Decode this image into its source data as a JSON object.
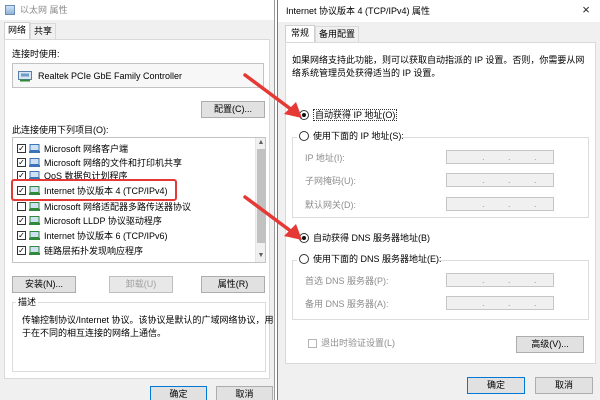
{
  "left_window": {
    "title": "以太网 属性",
    "tabs": [
      "网络",
      "共享"
    ],
    "connect_using_label": "连接时使用:",
    "adapter_name": "Realtek PCIe GbE Family Controller",
    "configure_button": "配置(C)...",
    "items_label": "此连接使用下列项目(O):",
    "items": [
      {
        "label": "Microsoft 网络客户端",
        "checked": true
      },
      {
        "label": "Microsoft 网络的文件和打印机共享",
        "checked": true
      },
      {
        "label": "QoS 数据包计划程序",
        "checked": true
      },
      {
        "label": "Internet 协议版本 4 (TCP/IPv4)",
        "checked": true
      },
      {
        "label": "Microsoft 网络适配器多路传送器协议",
        "checked": false
      },
      {
        "label": "Microsoft LLDP 协议驱动程序",
        "checked": true
      },
      {
        "label": "Internet 协议版本 6 (TCP/IPv6)",
        "checked": true
      },
      {
        "label": "链路层拓扑发现响应程序",
        "checked": true
      }
    ],
    "install_button": "安装(N)...",
    "uninstall_button": "卸载(U)",
    "properties_button": "属性(R)",
    "description_label": "描述",
    "description_text_1": "传输控制协议/Internet 协议。该协议是默认的广域网络协议，用",
    "description_text_2": "于在不同的相互连接的网络上通信。",
    "ok_button": "确定",
    "cancel_button": "取消"
  },
  "right_window": {
    "title": "Internet 协议版本 4 (TCP/IPv4) 属性",
    "tabs": [
      "常规",
      "备用配置"
    ],
    "intro_line_1": "如果网络支持此功能，则可以获取自动指派的 IP 设置。否则，你需要从网",
    "intro_line_2": "络系统管理员处获得适当的 IP 设置。",
    "auto_ip_radio": "自动获得 IP 地址(O)",
    "manual_ip_radio": "使用下面的 IP 地址(S):",
    "ip_address_label": "IP 地址(I):",
    "subnet_mask_label": "子网掩码(U):",
    "gateway_label": "默认网关(D):",
    "auto_dns_radio": "自动获得 DNS 服务器地址(B)",
    "manual_dns_radio": "使用下面的 DNS 服务器地址(E):",
    "preferred_dns_label": "首选 DNS 服务器(P):",
    "alternate_dns_label": "备用 DNS 服务器(A):",
    "validate_checkbox": "退出时验证设置(L)",
    "advanced_button": "高级(V)...",
    "ok_button": "确定",
    "cancel_button": "取消",
    "close_glyph": "×",
    "ip_dots": "."
  },
  "colors": {
    "annotation_red": "#e53935",
    "dialog_background": "#f0f0f0",
    "default_button_border": "#0078d7"
  },
  "icons": {
    "title_icon": "network-adapter-icon",
    "adapter_icon": "network-card-icon",
    "close_icon": "close-icon",
    "annotation_arrow": "red-arrow-icon"
  }
}
